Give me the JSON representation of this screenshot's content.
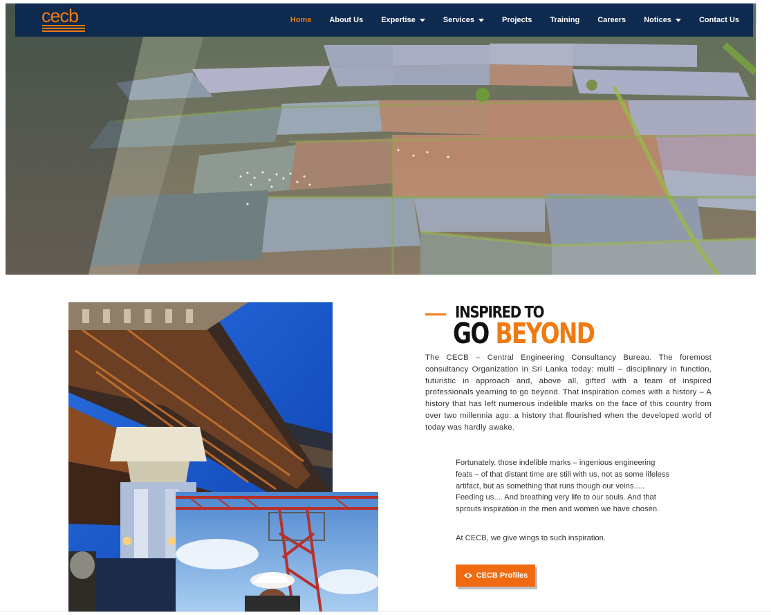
{
  "site": {
    "logo_text": "cecb"
  },
  "nav": {
    "items": [
      {
        "label": "Home",
        "active": true,
        "dropdown": false
      },
      {
        "label": "About Us",
        "active": false,
        "dropdown": false
      },
      {
        "label": "Expertise",
        "active": false,
        "dropdown": true
      },
      {
        "label": "Services",
        "active": false,
        "dropdown": true
      },
      {
        "label": "Projects",
        "active": false,
        "dropdown": false
      },
      {
        "label": "Training",
        "active": false,
        "dropdown": false
      },
      {
        "label": "Careers",
        "active": false,
        "dropdown": false
      },
      {
        "label": "Notices",
        "active": false,
        "dropdown": true
      },
      {
        "label": "Contact Us",
        "active": false,
        "dropdown": false
      }
    ]
  },
  "intro": {
    "heading_line1": "INSPIRED TO",
    "heading_line2_plain": "GO",
    "heading_line2_accent": "BEYOND",
    "paragraph1": "The CECB – Central Engineering Consultancy Bureau. The foremost consultancy Organization in Sri Lanka today: multi – disciplinary in function, futuristic in approach and, above all, gifted with a team of inspired professionals yearning to go beyond. That inspiration comes with a history – A history that has left numerous indelible marks on the face of this country from over two millennia ago: a history that flourished when the developed world of today was hardly awake.",
    "paragraph2": "Fortunately, those indelible marks – ingenious engineering feats – of that distant time are still with us, not as some lifeless artifact, but as something that runs though our veins..... Feeding us.... And breathing very life to our souls. And that sprouts inspiration in the men and women we have chosen.",
    "paragraph3": "At CECB, we give wings to such inspiration.",
    "button_label": "CECB Profiles",
    "button_icon": "eye-icon"
  },
  "colors": {
    "header_bg": "#0e2a4e",
    "accent": "#f07a12",
    "button": "#f06a12"
  }
}
